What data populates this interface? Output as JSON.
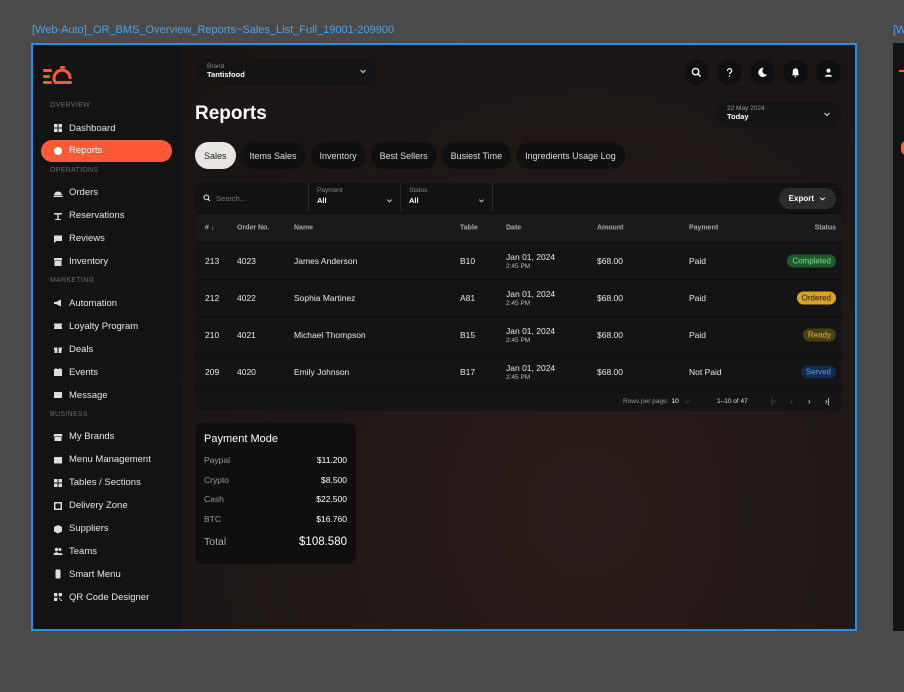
{
  "frame_title": "[Web-Auto]_OR_BMS_Overview_Reports~Sales_List_Full_19001-209900",
  "frame_title_2": "[W",
  "sidebar": {
    "sections": [
      {
        "label": "OVERVIEW",
        "items": [
          {
            "label": "Dashboard",
            "icon": "dashboard-icon"
          },
          {
            "label": "Reports",
            "icon": "reports-icon",
            "active": true
          }
        ]
      },
      {
        "label": "OPERATIONS",
        "items": [
          {
            "label": "Orders",
            "icon": "cloche-icon"
          },
          {
            "label": "Reservations",
            "icon": "table-icon"
          },
          {
            "label": "Reviews",
            "icon": "chat-icon"
          },
          {
            "label": "Inventory",
            "icon": "archive-icon"
          }
        ]
      },
      {
        "label": "MARKETING",
        "items": [
          {
            "label": "Automation",
            "icon": "megaphone-icon"
          },
          {
            "label": "Loyalty Program",
            "icon": "ticket-icon"
          },
          {
            "label": "Deals",
            "icon": "gift-icon"
          },
          {
            "label": "Events",
            "icon": "calendar-icon"
          },
          {
            "label": "Message",
            "icon": "mail-icon"
          }
        ]
      },
      {
        "label": "BUSINESS",
        "items": [
          {
            "label": "My Brands",
            "icon": "store-icon"
          },
          {
            "label": "Menu Management",
            "icon": "menu-book-icon"
          },
          {
            "label": "Tables / Sections",
            "icon": "grid-icon"
          },
          {
            "label": "Delivery Zone",
            "icon": "zone-icon"
          },
          {
            "label": "Suppliers",
            "icon": "box-icon"
          },
          {
            "label": "Teams",
            "icon": "people-icon"
          },
          {
            "label": "Smart Menu",
            "icon": "phone-icon"
          },
          {
            "label": "QR Code Designer",
            "icon": "qr-icon"
          }
        ]
      }
    ]
  },
  "header": {
    "brand_label": "Brand",
    "brand_value": "Tantisfood",
    "title": "Reports",
    "date_label": "22 May 2024",
    "date_value": "Today"
  },
  "tabs": [
    "Sales",
    "Items Sales",
    "Inventory",
    "Best Sellers",
    "Busiest Time",
    "Ingredients Usage Log"
  ],
  "filters": {
    "search_placeholder": "Search...",
    "payment_label": "Payment",
    "payment_value": "All",
    "status_label": "Status",
    "status_value": "All",
    "export_label": "Export"
  },
  "table": {
    "columns": [
      "# ↓",
      "Order No.",
      "Name",
      "Table",
      "Date",
      "Amount",
      "Payment",
      "Status"
    ],
    "rows": [
      {
        "num": "213",
        "order": "4023",
        "name": "James Anderson",
        "table": "B10",
        "date": "Jan 01, 2024",
        "time": "2:45 PM",
        "amount": "$68.00",
        "payment": "Paid",
        "status": "Completed"
      },
      {
        "num": "212",
        "order": "4022",
        "name": "Sophia Martinez",
        "table": "A81",
        "date": "Jan 01, 2024",
        "time": "2:45 PM",
        "amount": "$68.00",
        "payment": "Paid",
        "status": "Ordered"
      },
      {
        "num": "210",
        "order": "4021",
        "name": "Michael Thompson",
        "table": "B15",
        "date": "Jan 01, 2024",
        "time": "2:45 PM",
        "amount": "$68.00",
        "payment": "Paid",
        "status": "Ready"
      },
      {
        "num": "209",
        "order": "4020",
        "name": "Emily Johnson",
        "table": "B17",
        "date": "Jan 01, 2024",
        "time": "2:45 PM",
        "amount": "$68.00",
        "payment": "Not Paid",
        "status": "Served"
      }
    ],
    "rows_per_page_label": "Rows per page:",
    "rows_per_page_value": "10",
    "range": "1–10 of 47"
  },
  "status_colors": {
    "Completed": {
      "bg": "#1f5a2a",
      "fg": "#7ee08c"
    },
    "Ordered": {
      "bg": "#d9a521",
      "fg": "#1a1206"
    },
    "Ready": {
      "bg": "#4a3e12",
      "fg": "#d8b846"
    },
    "Served": {
      "bg": "#132a4d",
      "fg": "#5b9cf0"
    }
  },
  "payment_mode": {
    "title": "Payment Mode",
    "items": [
      {
        "label": "Paypal",
        "value": "$11.200"
      },
      {
        "label": "Crypto",
        "value": "$8.500"
      },
      {
        "label": "Cash",
        "value": "$22.500"
      },
      {
        "label": "BTC",
        "value": "$16.760"
      }
    ],
    "total_label": "Total",
    "total_value": "$108.580"
  },
  "accent_color": "#ff5a36"
}
